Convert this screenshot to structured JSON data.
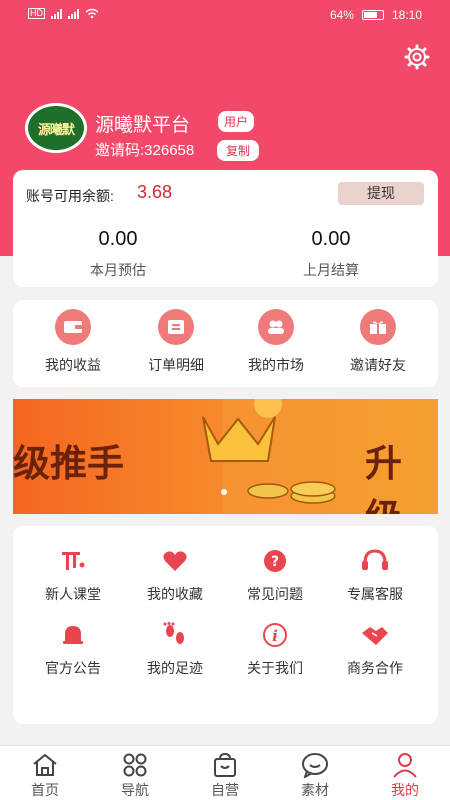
{
  "status_bar": {
    "left_icons": "HD 4G 4G wifi",
    "battery": "64%",
    "time": "18:10"
  },
  "profile": {
    "avatar_text": "源曦默",
    "name": "源曦默平台",
    "role": "用户",
    "invite": "邀请码:326658",
    "copy_label": "复制"
  },
  "balance": {
    "label": "账号可用余额:",
    "amount": "3.68",
    "withdraw_label": "提现",
    "stats": [
      {
        "value": "0.00",
        "label": "本月预估"
      },
      {
        "value": "0.00",
        "label": "上月结算"
      }
    ]
  },
  "quick_links": [
    {
      "label": "我的收益",
      "icon": "wallet-icon"
    },
    {
      "label": "订单明细",
      "icon": "order-list-icon"
    },
    {
      "label": "我的市场",
      "icon": "market-people-icon"
    },
    {
      "label": "邀请好友",
      "icon": "gift-icon"
    }
  ],
  "banner": {
    "left_text": "级推手",
    "right_text": "升级"
  },
  "services": [
    {
      "label": "新人课堂",
      "icon": "classroom-icon"
    },
    {
      "label": "我的收藏",
      "icon": "heart-icon"
    },
    {
      "label": "常见问题",
      "icon": "question-icon"
    },
    {
      "label": "专属客服",
      "icon": "headset-icon"
    },
    {
      "label": "官方公告",
      "icon": "bell-icon"
    },
    {
      "label": "我的足迹",
      "icon": "footprint-icon"
    },
    {
      "label": "关于我们",
      "icon": "info-icon"
    },
    {
      "label": "商务合作",
      "icon": "handshake-icon"
    }
  ],
  "tabs": [
    {
      "label": "首页",
      "icon": "home-icon"
    },
    {
      "label": "导航",
      "icon": "grid-icon"
    },
    {
      "label": "自营",
      "icon": "shopping-bag-icon"
    },
    {
      "label": "素材",
      "icon": "chat-bubble-icon"
    },
    {
      "label": "我的",
      "icon": "user-icon",
      "active": true
    }
  ],
  "colors": {
    "brand": "#f24869",
    "accent_red": "#d9262b",
    "icon_red": "#e8454f",
    "active_tab": "#e23a4d"
  }
}
